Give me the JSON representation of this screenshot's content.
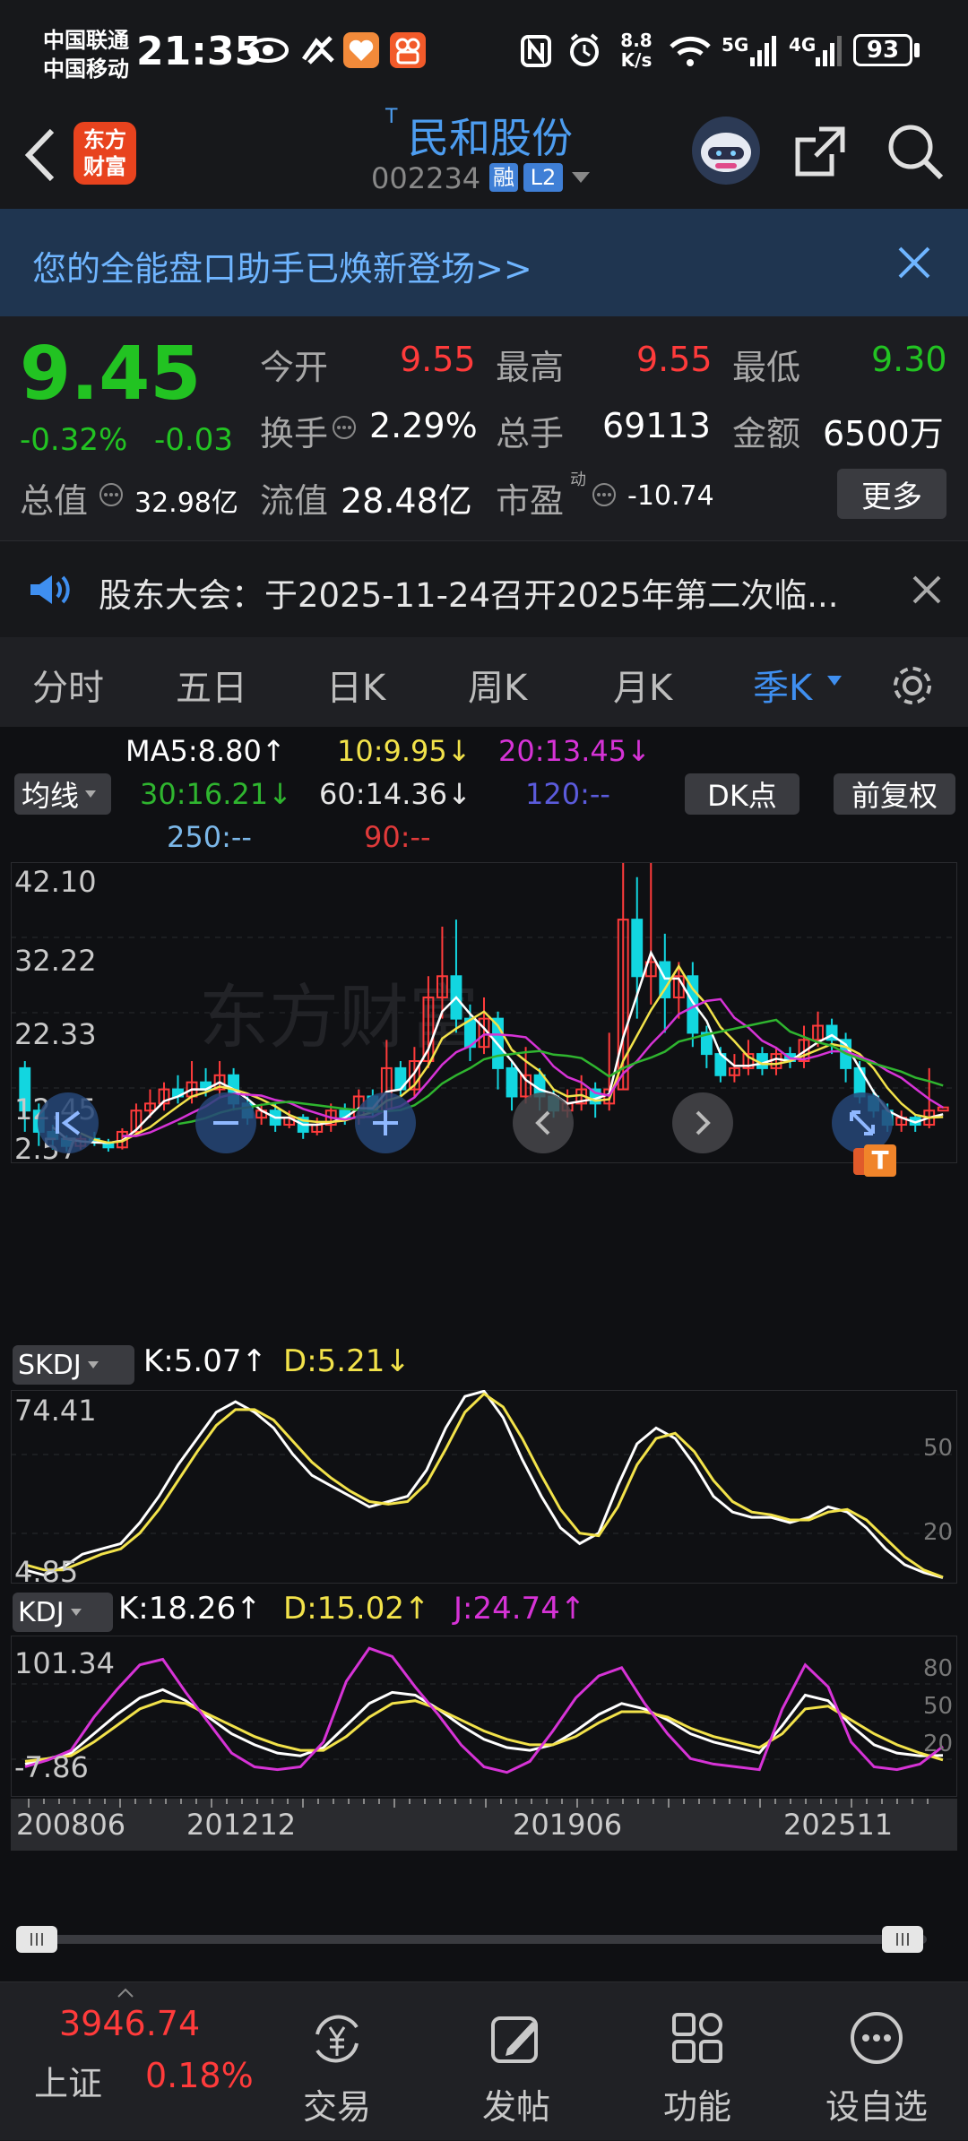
{
  "status": {
    "carrier1": "中国联通",
    "carrier2": "中国移动",
    "time": "21:35",
    "net_speed_value": "8.8",
    "net_speed_unit": "K/s",
    "signal1": "5G",
    "signal2": "4G",
    "battery": "93"
  },
  "header": {
    "logo_line1": "东方",
    "logo_line2": "财富",
    "stock_prefix": "T",
    "stock_name": "民和股份",
    "stock_code": "002234",
    "badge_rong": "融",
    "badge_l2": "L2"
  },
  "banner": {
    "text": "您的全能盘口助手已焕新登场>>"
  },
  "quote": {
    "price": "9.45",
    "change_pct": "-0.32%",
    "change": "-0.03",
    "open_label": "今开",
    "open": "9.55",
    "high_label": "最高",
    "high": "9.55",
    "low_label": "最低",
    "low": "9.30",
    "turnover_label": "换手",
    "turnover": "2.29%",
    "volume_label": "总手",
    "volume": "69113",
    "amount_label": "金额",
    "amount": "6500万",
    "mcap_label": "总值",
    "mcap": "32.98亿",
    "float_label": "流值",
    "float": "28.48亿",
    "pe_label": "市盈",
    "pe_sup": "动",
    "pe": "-10.74",
    "more_label": "更多"
  },
  "notice": {
    "text": "股东大会：于2025-11-24召开2025年第二次临..."
  },
  "tabs": {
    "items": [
      "分时",
      "五日",
      "日K",
      "周K",
      "月K",
      "季K"
    ],
    "active": "季K"
  },
  "chart_controls": {
    "ma_button": "均线",
    "dk_button": "DK点",
    "adj_button": "前复权",
    "ma": [
      {
        "label": "MA5:8.80↑",
        "color": "#ffffff"
      },
      {
        "label": "10:9.95↓",
        "color": "#f2e24a"
      },
      {
        "label": "20:13.45↓",
        "color": "#d633d6"
      },
      {
        "label": "30:16.21↓",
        "color": "#2fb52f"
      },
      {
        "label": "60:14.36↓",
        "color": "#e6e6e6"
      },
      {
        "label": "120:--",
        "color": "#5b5bdc"
      },
      {
        "label": "250:--",
        "color": "#7bb7e8"
      },
      {
        "label": "90:--",
        "color": "#e03a3a"
      }
    ],
    "watermark": "东方财富"
  },
  "chart_data": [
    {
      "type": "candlestick",
      "ylim": [
        2.57,
        42.1
      ],
      "y_ticks": [
        "42.10",
        "32.22",
        "22.33",
        "12.45",
        "2.57"
      ],
      "x_ticks": [
        "200806",
        "201212",
        "201906",
        "202511"
      ],
      "candles": [
        {
          "o": 15,
          "c": 9,
          "h": 16,
          "l": 6
        },
        {
          "o": 9,
          "c": 6,
          "h": 10,
          "l": 4
        },
        {
          "o": 6,
          "c": 5,
          "h": 7,
          "l": 3.5
        },
        {
          "o": 5,
          "c": 4,
          "h": 5.5,
          "l": 3.2
        },
        {
          "o": 4,
          "c": 5,
          "h": 5.5,
          "l": 3.5
        },
        {
          "o": 5,
          "c": 4.5,
          "h": 6,
          "l": 4
        },
        {
          "o": 4.5,
          "c": 3.8,
          "h": 5,
          "l": 3.2
        },
        {
          "o": 3.8,
          "c": 6,
          "h": 6.5,
          "l": 3.5
        },
        {
          "o": 6,
          "c": 9,
          "h": 10,
          "l": 5.5
        },
        {
          "o": 9,
          "c": 10,
          "h": 12,
          "l": 8
        },
        {
          "o": 10,
          "c": 12,
          "h": 13,
          "l": 9
        },
        {
          "o": 12,
          "c": 11,
          "h": 14,
          "l": 10
        },
        {
          "o": 11,
          "c": 13,
          "h": 16,
          "l": 10
        },
        {
          "o": 13,
          "c": 12,
          "h": 15,
          "l": 11
        },
        {
          "o": 12,
          "c": 14,
          "h": 16,
          "l": 11
        },
        {
          "o": 14,
          "c": 10,
          "h": 15,
          "l": 9
        },
        {
          "o": 10,
          "c": 8,
          "h": 11,
          "l": 7
        },
        {
          "o": 8,
          "c": 9,
          "h": 10,
          "l": 7
        },
        {
          "o": 9,
          "c": 7,
          "h": 10,
          "l": 6
        },
        {
          "o": 7,
          "c": 8,
          "h": 9,
          "l": 6.5
        },
        {
          "o": 8,
          "c": 6,
          "h": 8.5,
          "l": 5
        },
        {
          "o": 6,
          "c": 7,
          "h": 8,
          "l": 5.5
        },
        {
          "o": 7,
          "c": 9,
          "h": 10,
          "l": 6
        },
        {
          "o": 9,
          "c": 8,
          "h": 10,
          "l": 7
        },
        {
          "o": 8,
          "c": 11,
          "h": 12,
          "l": 7
        },
        {
          "o": 11,
          "c": 9,
          "h": 12,
          "l": 8
        },
        {
          "o": 9,
          "c": 15,
          "h": 19,
          "l": 8
        },
        {
          "o": 15,
          "c": 12,
          "h": 16,
          "l": 11
        },
        {
          "o": 12,
          "c": 16,
          "h": 18,
          "l": 11
        },
        {
          "o": 16,
          "c": 25,
          "h": 28,
          "l": 15
        },
        {
          "o": 25,
          "c": 28,
          "h": 35,
          "l": 22
        },
        {
          "o": 28,
          "c": 22,
          "h": 36,
          "l": 20
        },
        {
          "o": 22,
          "c": 18,
          "h": 24,
          "l": 16
        },
        {
          "o": 18,
          "c": 22,
          "h": 25,
          "l": 17
        },
        {
          "o": 22,
          "c": 15,
          "h": 23,
          "l": 12
        },
        {
          "o": 15,
          "c": 11,
          "h": 16,
          "l": 9
        },
        {
          "o": 11,
          "c": 14,
          "h": 18,
          "l": 10
        },
        {
          "o": 14,
          "c": 11,
          "h": 15,
          "l": 9
        },
        {
          "o": 11,
          "c": 9,
          "h": 12,
          "l": 8
        },
        {
          "o": 9,
          "c": 10,
          "h": 12,
          "l": 8
        },
        {
          "o": 10,
          "c": 12,
          "h": 14,
          "l": 9
        },
        {
          "o": 12,
          "c": 10,
          "h": 13,
          "l": 8
        },
        {
          "o": 10,
          "c": 12,
          "h": 20,
          "l": 9
        },
        {
          "o": 12,
          "c": 36,
          "h": 44,
          "l": 12
        },
        {
          "o": 36,
          "c": 28,
          "h": 42,
          "l": 22
        },
        {
          "o": 28,
          "c": 30,
          "h": 44,
          "l": 24
        },
        {
          "o": 30,
          "c": 25,
          "h": 34,
          "l": 20
        },
        {
          "o": 25,
          "c": 28,
          "h": 30,
          "l": 22
        },
        {
          "o": 28,
          "c": 20,
          "h": 30,
          "l": 18
        },
        {
          "o": 20,
          "c": 17,
          "h": 21,
          "l": 15
        },
        {
          "o": 17,
          "c": 14,
          "h": 18,
          "l": 13
        },
        {
          "o": 14,
          "c": 15,
          "h": 17,
          "l": 13
        },
        {
          "o": 15,
          "c": 17,
          "h": 19,
          "l": 14
        },
        {
          "o": 17,
          "c": 15,
          "h": 18,
          "l": 14
        },
        {
          "o": 15,
          "c": 17,
          "h": 18,
          "l": 14
        },
        {
          "o": 17,
          "c": 16,
          "h": 18,
          "l": 15
        },
        {
          "o": 16,
          "c": 19,
          "h": 21,
          "l": 15
        },
        {
          "o": 19,
          "c": 21,
          "h": 23,
          "l": 18
        },
        {
          "o": 21,
          "c": 19,
          "h": 22,
          "l": 17
        },
        {
          "o": 19,
          "c": 15,
          "h": 20,
          "l": 13
        },
        {
          "o": 15,
          "c": 11,
          "h": 16,
          "l": 10
        },
        {
          "o": 11,
          "c": 9,
          "h": 12,
          "l": 8
        },
        {
          "o": 9,
          "c": 7,
          "h": 10,
          "l": 6
        },
        {
          "o": 7,
          "c": 8,
          "h": 9,
          "l": 6
        },
        {
          "o": 8,
          "c": 7,
          "h": 8.5,
          "l": 6
        },
        {
          "o": 7,
          "c": 9,
          "h": 15,
          "l": 6.5
        },
        {
          "o": 9,
          "c": 9.45,
          "h": 9.55,
          "l": 9.3
        }
      ]
    },
    {
      "type": "line",
      "name": "SKDJ",
      "ylim": [
        4.85,
        74.41
      ],
      "y_ticks": [
        "74.41",
        "4.85"
      ],
      "right_ticks": [
        "50",
        "20"
      ],
      "series": [
        {
          "name": "K",
          "color": "#ffffff",
          "values": [
            8,
            6,
            9,
            14,
            16,
            18,
            26,
            36,
            48,
            58,
            68,
            72,
            68,
            62,
            52,
            44,
            40,
            36,
            32,
            34,
            36,
            46,
            62,
            74,
            76,
            66,
            50,
            36,
            24,
            18,
            22,
            40,
            56,
            62,
            58,
            48,
            36,
            30,
            28,
            28,
            26,
            28,
            32,
            30,
            24,
            16,
            10,
            7,
            5.07
          ]
        },
        {
          "name": "D",
          "color": "#f2e24a",
          "values": [
            10,
            8,
            8,
            11,
            14,
            16,
            22,
            31,
            42,
            53,
            63,
            69,
            69,
            65,
            57,
            49,
            43,
            38,
            34,
            33,
            34,
            41,
            54,
            68,
            75,
            70,
            58,
            44,
            31,
            22,
            21,
            32,
            48,
            58,
            60,
            53,
            42,
            34,
            30,
            29,
            27,
            27,
            30,
            31,
            27,
            20,
            13,
            8,
            5.21
          ]
        }
      ]
    },
    {
      "type": "line",
      "name": "KDJ",
      "ylim": [
        -7.86,
        101.34
      ],
      "y_ticks": [
        "101.34",
        "-7.86"
      ],
      "right_ticks": [
        "80",
        "50",
        "20"
      ],
      "series": [
        {
          "name": "K",
          "color": "#ffffff",
          "values": [
            12,
            16,
            20,
            34,
            48,
            60,
            66,
            58,
            46,
            34,
            26,
            20,
            18,
            24,
            40,
            56,
            64,
            62,
            52,
            40,
            30,
            24,
            22,
            26,
            36,
            48,
            56,
            52,
            44,
            34,
            28,
            24,
            20,
            40,
            62,
            58,
            40,
            26,
            20,
            18,
            18.26
          ]
        },
        {
          "name": "D",
          "color": "#f2e24a",
          "values": [
            14,
            16,
            18,
            28,
            40,
            52,
            58,
            56,
            48,
            40,
            32,
            26,
            22,
            22,
            32,
            46,
            56,
            58,
            52,
            44,
            36,
            30,
            26,
            26,
            32,
            42,
            50,
            50,
            46,
            38,
            32,
            28,
            24,
            34,
            52,
            54,
            44,
            34,
            26,
            20,
            15.02
          ]
        },
        {
          "name": "J",
          "color": "#d633d6",
          "values": [
            10,
            15,
            22,
            46,
            66,
            84,
            88,
            64,
            42,
            20,
            10,
            8,
            10,
            28,
            72,
            96,
            90,
            68,
            48,
            26,
            10,
            6,
            14,
            36,
            60,
            76,
            82,
            56,
            34,
            16,
            12,
            10,
            8,
            52,
            84,
            68,
            28,
            10,
            8,
            12,
            24.74
          ]
        }
      ]
    }
  ],
  "bottom_nav": {
    "index_name": "上证",
    "index_value": "3946.74",
    "index_change": "0.18%",
    "items": [
      {
        "label": "交易",
        "icon": "yuan-exchange-icon"
      },
      {
        "label": "发帖",
        "icon": "edit-post-icon"
      },
      {
        "label": "功能",
        "icon": "grid-icon"
      },
      {
        "label": "设自选",
        "icon": "more-dots-icon"
      }
    ]
  }
}
